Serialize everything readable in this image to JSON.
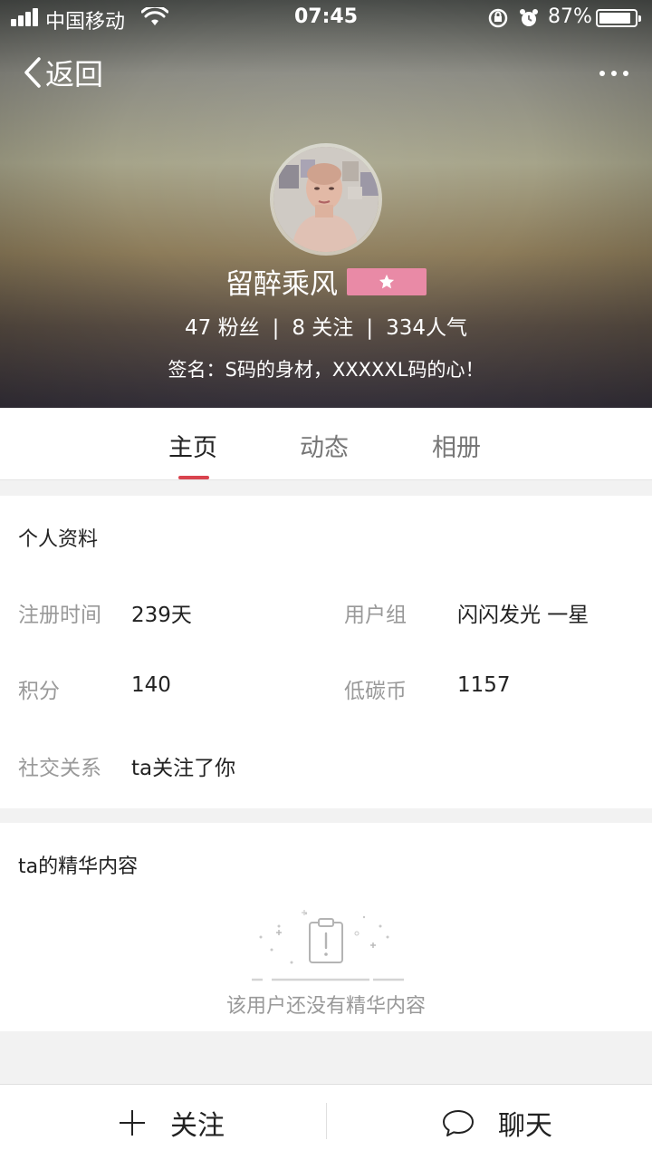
{
  "status_bar": {
    "carrier": "中国移动",
    "time": "07:45",
    "battery": "87%"
  },
  "nav": {
    "back_label": "返回"
  },
  "profile": {
    "username": "留醉乘风",
    "stats": {
      "fans": "47 粉丝",
      "following": "8 关注",
      "popularity": "334人气",
      "separator": "|"
    },
    "signature": "签名：S码的身材，XXXXXL码的心！"
  },
  "tabs": [
    {
      "label": "主页",
      "active": true
    },
    {
      "label": "动态",
      "active": false
    },
    {
      "label": "相册",
      "active": false
    }
  ],
  "personal_info": {
    "title": "个人资料",
    "register_label": "注册时间",
    "register_value": "239天",
    "group_label": "用户组",
    "group_value": "闪闪发光 一星",
    "points_label": "积分",
    "points_value": "140",
    "coins_label": "低碳币",
    "coins_value": "1157",
    "social_label": "社交关系",
    "social_value": "ta关注了你"
  },
  "featured": {
    "title": "ta的精华内容",
    "empty_text": "该用户还没有精华内容"
  },
  "bottom_bar": {
    "follow_label": "关注",
    "chat_label": "聊天"
  },
  "colors": {
    "accent": "#d9434e",
    "badge": "#e98aa6"
  }
}
